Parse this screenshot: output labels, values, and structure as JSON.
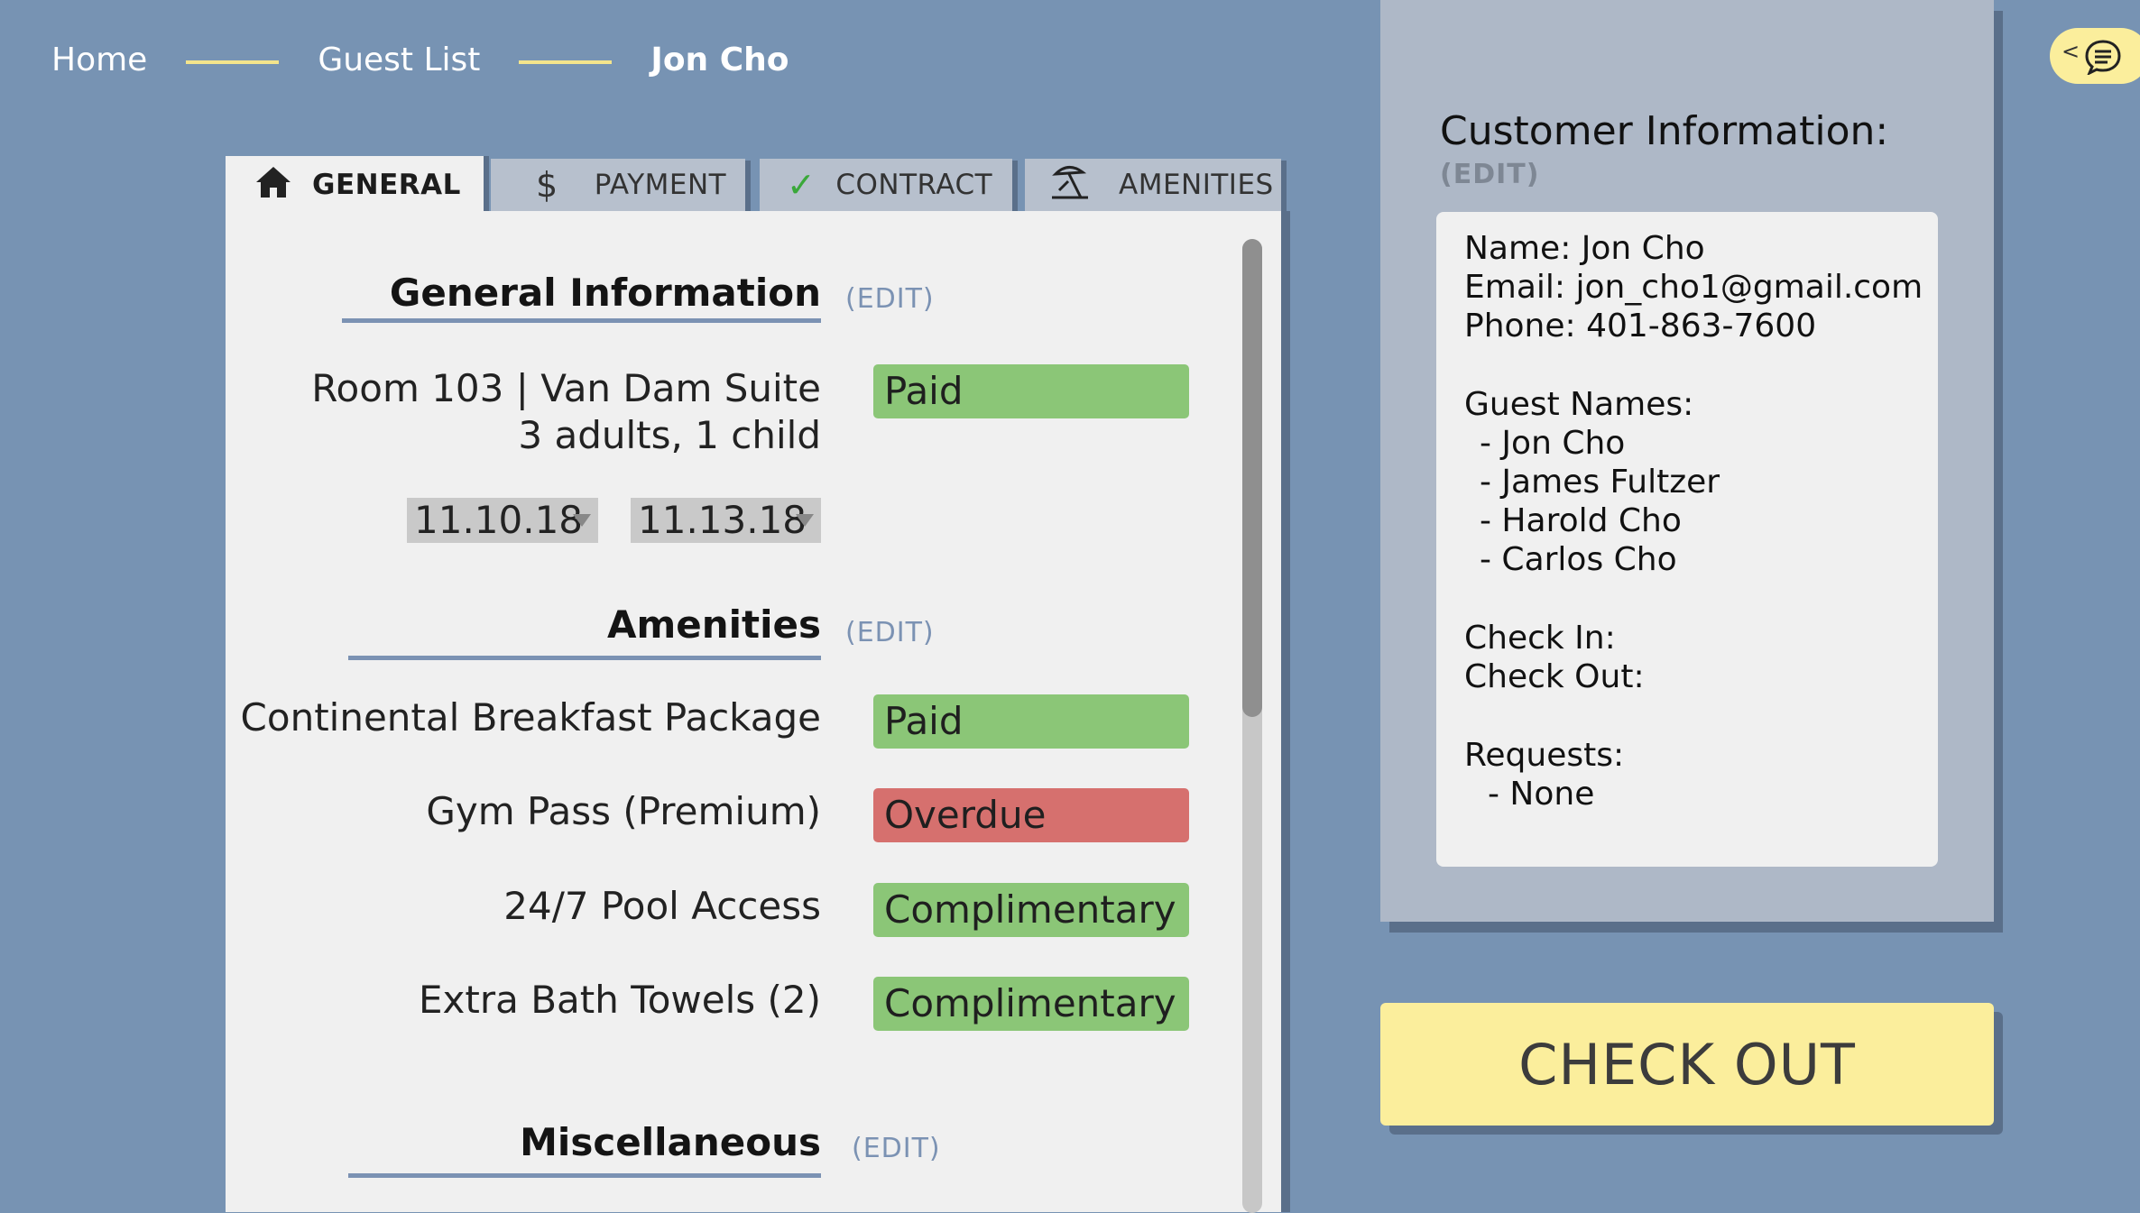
{
  "breadcrumb": {
    "home": "Home",
    "guest_list": "Guest List",
    "current": "Jon Cho"
  },
  "tabs": [
    {
      "label": "GENERAL",
      "icon": "home-icon",
      "active": true
    },
    {
      "label": "PAYMENT",
      "icon": "dollar-icon",
      "active": false
    },
    {
      "label": "CONTRACT",
      "icon": "checkmark-icon",
      "active": false
    },
    {
      "label": "AMENITIES",
      "icon": "beach-umbrella-icon",
      "active": false
    }
  ],
  "general": {
    "title": "General Information",
    "edit": "(EDIT)",
    "room": "Room 103 | Van Dam Suite",
    "guests": "3 adults, 1 child",
    "status": "Paid",
    "check_in_date": "11.10.18",
    "check_out_date": "11.13.18"
  },
  "amenities": {
    "title": "Amenities",
    "edit": "(EDIT)",
    "items": [
      {
        "name": "Continental Breakfast Package",
        "status": "Paid",
        "color": "#8bc677"
      },
      {
        "name": "Gym Pass (Premium)",
        "status": "Overdue",
        "color": "#d6706e"
      },
      {
        "name": "24/7 Pool Access",
        "status": "Complimentary",
        "color": "#8bc677"
      },
      {
        "name": "Extra Bath Towels (2)",
        "status": "Complimentary",
        "color": "#8bc677"
      }
    ]
  },
  "misc": {
    "title": "Miscellaneous",
    "edit": "(EDIT)"
  },
  "customer": {
    "title": "Customer Information:",
    "edit": "(EDIT)",
    "name_line": "Name: Jon Cho",
    "email_line": "Email: jon_cho1@gmail.com",
    "phone_line": "Phone: 401-863-7600",
    "guest_names_label": "Guest Names:",
    "guest_names": [
      "- Jon Cho",
      "- James Fultzer",
      "- Harold Cho",
      "- Carlos Cho"
    ],
    "check_in_label": "Check In:",
    "check_out_label": "Check Out:",
    "requests_label": "Requests:",
    "requests": [
      "- None"
    ]
  },
  "checkout_label": "CHECK OUT",
  "chat": {
    "collapse_glyph": "<",
    "icon": "chat-icon"
  },
  "colors": {
    "background": "#7793b3",
    "accent_yellow": "#fbee9c",
    "paid_green": "#8bc677",
    "overdue_red": "#d6706e"
  }
}
